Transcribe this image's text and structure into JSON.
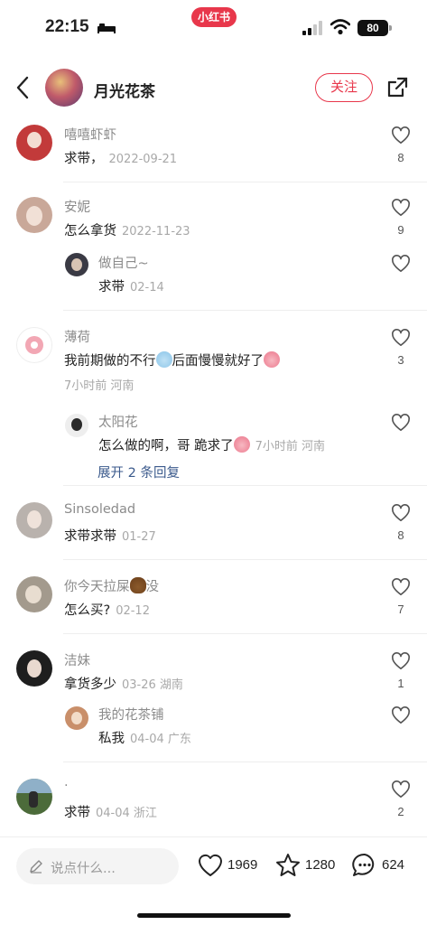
{
  "status_bar": {
    "time": "22:15",
    "app_badge": "小红书",
    "battery": "80"
  },
  "header": {
    "title": "月光花茶",
    "follow_label": "关注"
  },
  "comments": [
    {
      "name": "嘻嘻虾虾",
      "text": "求带，",
      "meta": "2022-09-21",
      "likes": "8",
      "avatar_color": "#c23a3a"
    },
    {
      "name": "安妮",
      "text": "怎么拿货",
      "meta": "2022-11-23",
      "likes": "9",
      "avatar_color": "#c9a899",
      "reply": {
        "name": "做自己~",
        "text": "求带",
        "meta": "02-14",
        "avatar_color": "#3a3a44"
      }
    },
    {
      "name": "薄荷",
      "text_a": "我前期做的不行",
      "text_b": "后面慢慢就好了",
      "meta_line": "7小时前 河南",
      "likes": "3",
      "avatar_color": "#f6d8dc",
      "reply": {
        "name": "太阳花",
        "text": "怎么做的啊，哥 跪求了",
        "meta": "7小时前 河南",
        "avatar_color": "#2a2a2a"
      },
      "expand_label": "展开 2 条回复"
    },
    {
      "name": "Sinsoledad",
      "text": "求带求带",
      "meta": "01-27",
      "likes": "8",
      "avatar_color": "#b9b2ad"
    },
    {
      "name_a": "你今天拉屎",
      "name_b": "没",
      "text": "怎么买?",
      "meta": "02-12",
      "likes": "7",
      "avatar_color": "#a39a8d"
    },
    {
      "name": "洁妹",
      "text": "拿货多少",
      "meta": "03-26 湖南",
      "likes": "1",
      "avatar_color": "#1e1e1e",
      "reply": {
        "name": "我的花茶铺",
        "text": "私我",
        "meta": "04-04 广东",
        "avatar_color": "#c98f6a"
      }
    },
    {
      "name": ".",
      "text": "求带",
      "meta": "04-04 浙江",
      "likes": "2",
      "avatar_color": "#4c6b3a"
    }
  ],
  "bottom_bar": {
    "placeholder": "说点什么...",
    "likes": "1969",
    "stars": "1280",
    "comments": "624"
  }
}
